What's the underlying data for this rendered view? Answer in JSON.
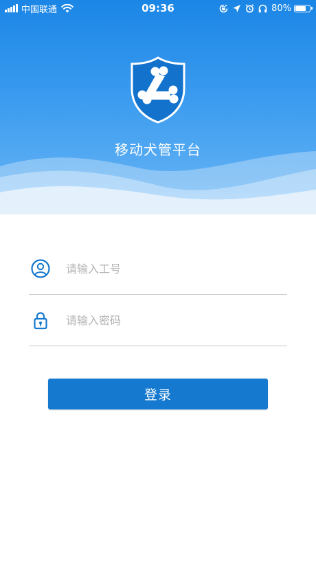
{
  "status_bar": {
    "carrier": "中国联通",
    "time": "09:36",
    "battery_percent": "80%",
    "battery_level": 0.8,
    "icons": [
      "signal-icon",
      "wifi-icon",
      "screen-rotation-lock-icon",
      "location-arrow-icon",
      "alarm-icon",
      "headphones-icon",
      "battery-icon"
    ]
  },
  "header": {
    "logo_icon": "shield-bone-icon",
    "title": "移动犬管平台"
  },
  "form": {
    "username": {
      "icon": "user-circle-icon",
      "placeholder": "请输入工号",
      "value": ""
    },
    "password": {
      "icon": "lock-icon",
      "placeholder": "请输入密码",
      "value": ""
    },
    "login_label": "登录"
  },
  "colors": {
    "header_top": "#1b86e6",
    "header_bottom": "#6bb6f5",
    "accent": "#1479cf",
    "placeholder": "#b3b3b3",
    "divider": "#c6c6c6"
  }
}
